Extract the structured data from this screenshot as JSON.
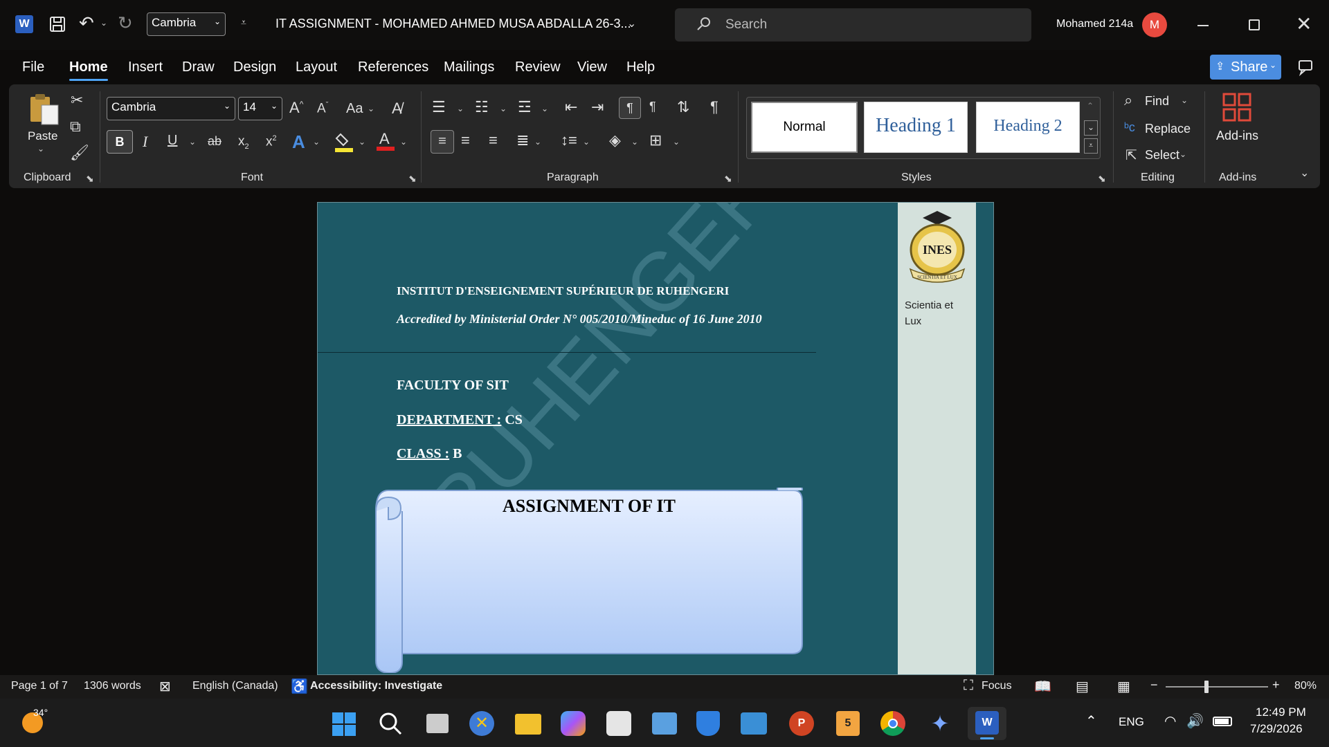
{
  "titlebar": {
    "font_name": "Cambria",
    "document_title": "IT ASSIGNMENT - MOHAMED AHMED MUSA ABDALLA 26-3...",
    "search_placeholder": "Search",
    "user_name": "Mohamed 214a",
    "avatar_letter": "M"
  },
  "menu": {
    "items": [
      "File",
      "Home",
      "Insert",
      "Draw",
      "Design",
      "Layout",
      "References",
      "Mailings",
      "Review",
      "View",
      "Help"
    ],
    "share_label": "Share"
  },
  "ribbon": {
    "clipboard": {
      "paste_label": "Paste",
      "group_label": "Clipboard"
    },
    "font": {
      "font_name": "Cambria",
      "font_size": "14",
      "case_label": "Aa",
      "group_label": "Font"
    },
    "paragraph": {
      "group_label": "Paragraph"
    },
    "styles": {
      "normal": "Normal",
      "heading1": "Heading 1",
      "heading2": "Heading 2",
      "group_label": "Styles"
    },
    "editing": {
      "find": "Find",
      "replace": "Replace",
      "select": "Select",
      "group_label": "Editing"
    },
    "addins": {
      "label": "Add-ins",
      "group_label": "Add-ins"
    }
  },
  "document": {
    "institute": "INSTITUT D'ENSEIGNEMENT SUPÉRIEUR DE RUHENGERI",
    "accreditation": "Accredited by Ministerial Order N° 005/2010/Mineduc of 16 June 2010",
    "faculty": "FACULTY OF SIT",
    "department_label": "DEPARTMENT :",
    "department_value": " CS",
    "class_label": "CLASS :",
    "class_value": " B",
    "assignment_title": "ASSIGNMENT OF IT",
    "logo_text": "INES",
    "logo_motto_ribbon": "SCIENTIA ET LUX",
    "sidebar_motto_line1": "Scientia et",
    "sidebar_motto_line2": "Lux",
    "watermark_text": "RUHENGERI"
  },
  "statusbar": {
    "page": "Page 1 of 7",
    "words": "1306 words",
    "language": "English (Canada)",
    "accessibility": "Accessibility: Investigate",
    "focus": "Focus",
    "zoom": "80%"
  },
  "taskbar": {
    "weather_temp": "34°",
    "language": "ENG",
    "time": "12:49 PM",
    "date": "7/29/2026"
  },
  "colors": {
    "accent": "#4b8de0",
    "doc_background": "#1d5966",
    "sidebar": "#d4e1dc",
    "avatar": "#e84a3f"
  }
}
